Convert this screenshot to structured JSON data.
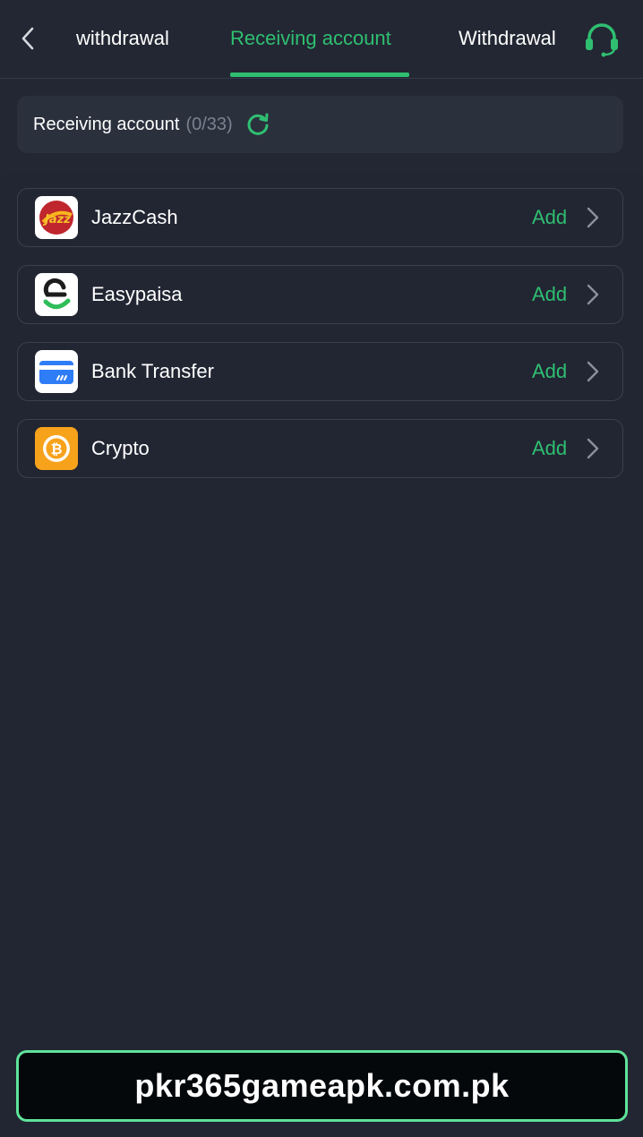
{
  "nav": {
    "tabs": [
      {
        "label": "withdrawal",
        "active": false
      },
      {
        "label": "Receiving account",
        "active": true
      },
      {
        "label": "Withdrawal",
        "active": false
      }
    ],
    "accent_color": "#2fbf71"
  },
  "header": {
    "title": "Receiving account",
    "count": "(0/33)"
  },
  "methods": [
    {
      "name": "JazzCash",
      "action": "Add",
      "icon": "jazzcash-logo"
    },
    {
      "name": "Easypaisa",
      "action": "Add",
      "icon": "easypaisa-logo"
    },
    {
      "name": "Bank Transfer",
      "action": "Add",
      "icon": "bank-card-icon"
    },
    {
      "name": "Crypto",
      "action": "Add",
      "icon": "bitcoin-icon"
    }
  ],
  "footer": {
    "banner_text": "pkr365gameapk.com.pk"
  }
}
